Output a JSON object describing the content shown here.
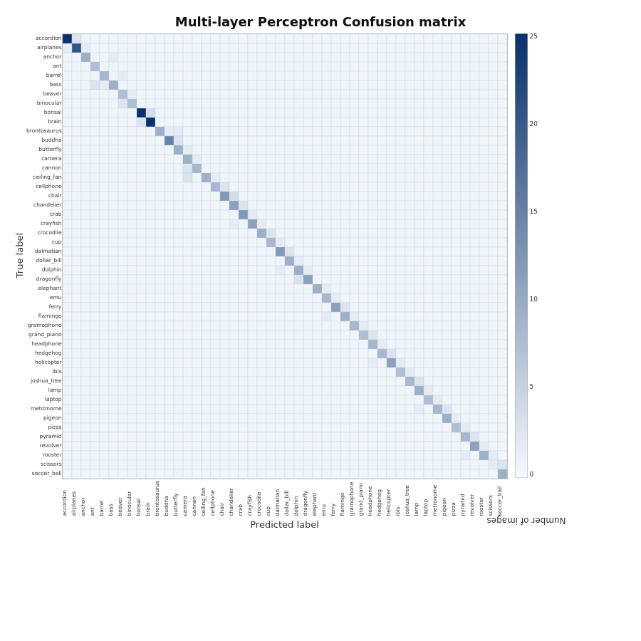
{
  "title": "Multi-layer Perceptron Confusion matrix",
  "x_axis_label": "Predicted label",
  "y_axis_label": "True label",
  "colorbar_label": "Number of images",
  "colorbar_ticks": [
    "25",
    "20",
    "15",
    "10",
    "5",
    "0"
  ],
  "classes": [
    "accordion",
    "airplanes",
    "anchor",
    "ant",
    "barrel",
    "bass",
    "beaver",
    "binocular",
    "bonsai",
    "brain",
    "brontosaurus",
    "buddha",
    "butterfly",
    "camera",
    "cannon",
    "ceiling_fan",
    "cellphone",
    "chair",
    "chandelier",
    "crab",
    "crayfish",
    "crocodile",
    "cup",
    "dalmatian",
    "dollar_bill",
    "dolphin",
    "dragonfly",
    "elephant",
    "emu",
    "ferry",
    "flamingo",
    "gramophone",
    "grand_piano",
    "headphone",
    "hedgehog",
    "helicopter",
    "ibis",
    "joshua_tree",
    "lamp",
    "laptop",
    "metronome",
    "pigeon",
    "pizza",
    "pyramid",
    "revolver",
    "rooster",
    "scissors",
    "soccer_ball"
  ],
  "accent_color": "#08306b",
  "diagonal_values": [
    27,
    22,
    10,
    8,
    9,
    10,
    8,
    8,
    28,
    27,
    10,
    16,
    10,
    10,
    9,
    10,
    9,
    13,
    12,
    13,
    12,
    10,
    9,
    13,
    10,
    10,
    12,
    10,
    9,
    12,
    10,
    9,
    8,
    9,
    9,
    12,
    8,
    9,
    10,
    8,
    9,
    10,
    8,
    9,
    12,
    10,
    2,
    10
  ]
}
